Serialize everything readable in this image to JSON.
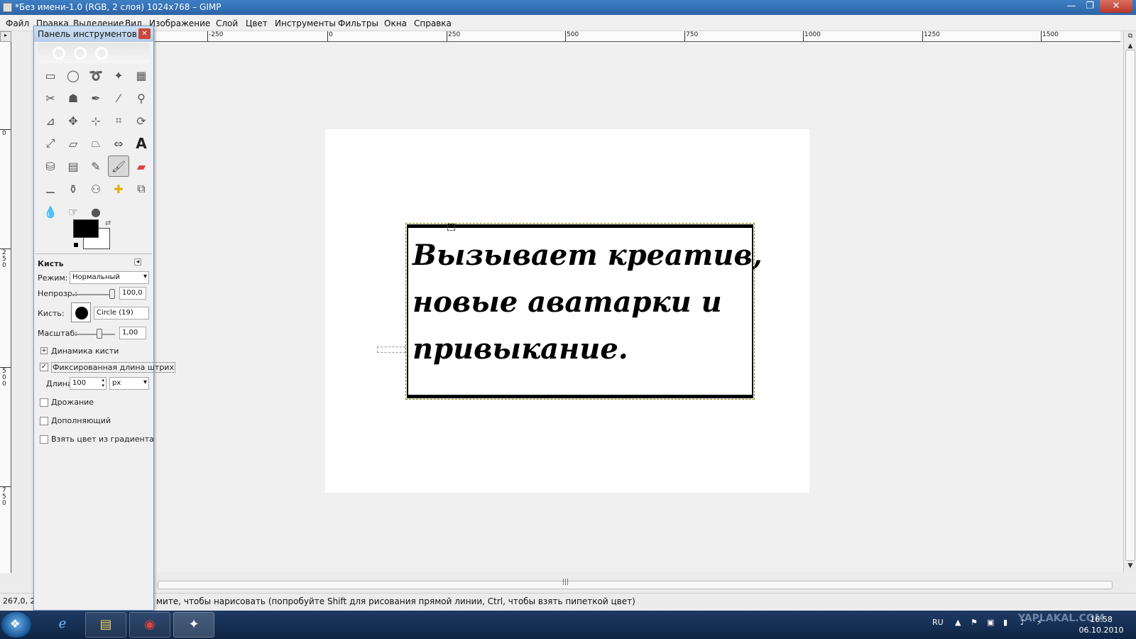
{
  "window": {
    "title": "*Без имени-1.0 (RGB, 2 слоя) 1024x768 – GIMP"
  },
  "menu": [
    "Файл",
    "Правка",
    "Выделение",
    "Вид",
    "Изображение",
    "Слой",
    "Цвет",
    "Инструменты",
    "Фильтры",
    "Окна",
    "Справка"
  ],
  "ruler": {
    "h_labels": [
      "-250",
      "0",
      "250",
      "500",
      "750",
      "1000",
      "1250",
      "1500"
    ],
    "v_labels": [
      "0",
      "2 5 0",
      "5 0 0",
      "7 5 0"
    ]
  },
  "canvas": {
    "text_lines": [
      "Вызывает креатив,",
      "новые аватарки и",
      "привыкание."
    ]
  },
  "toolbox": {
    "title": "Панель инструментов",
    "tools": [
      "rect-select",
      "ellipse-select",
      "free-select",
      "fuzzy-select",
      "color-select",
      "scissors",
      "foreground-select",
      "paths",
      "color-picker",
      "zoom",
      "measure",
      "move",
      "align",
      "crop",
      "rotate",
      "scale",
      "shear",
      "perspective",
      "flip",
      "text",
      "bucket-fill",
      "blend",
      "pencil",
      "paintbrush",
      "eraser",
      "airbrush",
      "ink",
      "clone",
      "heal",
      "perspective-clone",
      "blur",
      "smudge",
      "dodge-burn"
    ],
    "active_tool": "paintbrush",
    "colors": {
      "foreground": "#000000",
      "background": "#ffffff"
    },
    "options": {
      "title": "Кисть",
      "mode_label": "Режим:",
      "mode_value": "Нормальный",
      "opacity_label": "Непрозр.:",
      "opacity_value": "100,0",
      "opacity_level": 1.0,
      "brush_label": "Кисть:",
      "brush_value": "Circle (19)",
      "scale_label": "Масштаб:",
      "scale_value": "1,00",
      "dynamics_label": "Динамика кисти",
      "fixed_length_label": "Фиксированная длина штрих",
      "fixed_length_checked": true,
      "length_label": "Длина:",
      "length_value": "100",
      "length_unit": "px",
      "jitter_label": "Дрожание",
      "incremental_label": "Дополняющий",
      "gradient_label": "Взять цвет из градиента"
    }
  },
  "status": {
    "coords": "267,0, 2",
    "message": "мите, чтобы нарисовать (попробуйте Shift для рисования прямой линии, Ctrl, чтобы взять пипеткой цвет)"
  },
  "taskbar": {
    "lang": "RU",
    "time": "16:58",
    "date": "06.10.2010",
    "watermark": "YAPLAKAL.COM",
    "apps": [
      "internet-explorer-icon",
      "explorer-icon",
      "chrome-icon",
      "gimp-icon"
    ]
  }
}
